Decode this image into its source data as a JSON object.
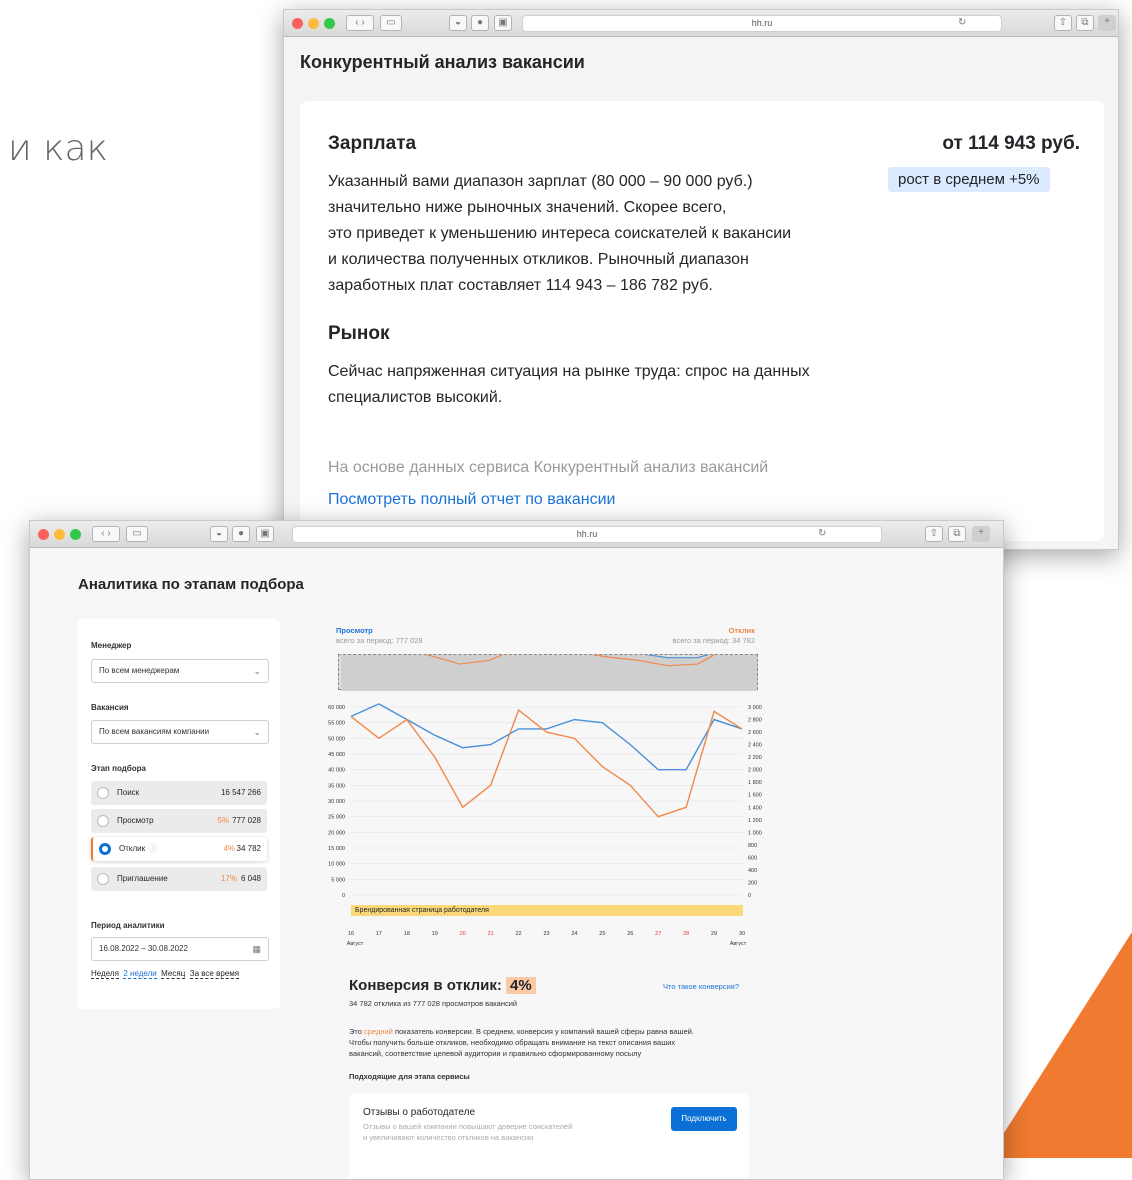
{
  "background": {
    "text": "и как",
    "accent": "#ef7a30"
  },
  "window1": {
    "url": "hh.ru",
    "title": "Конкурентный анализ вакансии",
    "salary": {
      "heading": "Зарплата",
      "value": "от 114 943 руб.",
      "badge": "рост в среднем +5%",
      "lines": [
        "Указанный вами диапазон зарплат (80 000 – 90 000 руб.)",
        "значительно ниже рыночных значений. Скорее всего,",
        "это приведет к уменьшению интереса соискателей к вакансии",
        "и количества полученных откликов. Рыночный диапазон",
        "заработных плат составляет 114 943 – 186 782 руб."
      ]
    },
    "market": {
      "heading": "Рынок",
      "lines": [
        "Сейчас напряженная ситуация на рынке труда: спрос на данных",
        "специалистов высокий."
      ]
    },
    "source_note": "На основе данных сервиса Конкурентный анализ вакансий",
    "full_report_link": "Посмотреть полный отчет по вакансии"
  },
  "window2": {
    "url": "hh.ru",
    "title": "Аналитика по этапам подбора",
    "manager": {
      "label": "Менеджер",
      "value": "По всем менеджерам"
    },
    "vacancy": {
      "label": "Вакансия",
      "value": "По всем вакансиям компании"
    },
    "stages": {
      "label": "Этап подбора",
      "items": [
        {
          "name": "Поиск",
          "pct": "",
          "value": "16 547 266",
          "selected": false
        },
        {
          "name": "Просмотр",
          "pct": "5%",
          "value": "777 028",
          "selected": false
        },
        {
          "name": "Отклик",
          "pct": "4%",
          "value": "34 782",
          "selected": true
        },
        {
          "name": "Приглашение",
          "pct": "17%",
          "value": "6 048",
          "selected": false
        }
      ]
    },
    "period": {
      "label": "Период аналитики",
      "value": "16.08.2022 – 30.08.2022",
      "links": [
        "Неделя",
        "2 недели",
        "Месяц",
        "За все время"
      ]
    },
    "conversion": {
      "title": "Конверсия в отклик:",
      "value": "4%",
      "subtitle": "34 782 отклика из 777 028 просмотров вакансий",
      "what_link": "Что такое конверсия?",
      "body_prefix": "Это",
      "body_highlight": "средний",
      "body_lines": [
        "показатель конверсии. В среднем, конверсия у компаний вашей сферы равна вашей.",
        "Чтобы получить больше откликов, необходимо обращать внимание на текст описания ваших",
        "вакансий, соответствие целевой аудитории и правильно сформированному посылу"
      ],
      "services_heading": "Подходящие для этапа сервисы"
    },
    "service": {
      "name": "Отзывы о работодателе",
      "desc1": "Отзывы о вашей компании повышают доверие соискателей",
      "desc2": "и увеличивают количество откликов на вакансии",
      "button": "Подключить"
    }
  },
  "chart_data": {
    "type": "line",
    "series": [
      {
        "name": "Просмотр",
        "color": "#4a90d9",
        "total_label": "всего за период: 777 028",
        "values": [
          57000,
          61000,
          56000,
          51000,
          47000,
          48000,
          53000,
          53000,
          56000,
          55000,
          48000,
          40000,
          40000,
          56000,
          53000
        ]
      },
      {
        "name": "Отклик",
        "color": "#f0884a",
        "total_label": "всего за период: 34 782",
        "values": [
          2850,
          2500,
          2800,
          2200,
          1400,
          1750,
          2950,
          2600,
          2500,
          2050,
          1750,
          1250,
          1400,
          2930,
          2650
        ]
      }
    ],
    "x": [
      "16",
      "17",
      "18",
      "19",
      "20",
      "21",
      "22",
      "23",
      "24",
      "25",
      "26",
      "27",
      "28",
      "29",
      "30"
    ],
    "weekend_x": [
      "20",
      "21",
      "27",
      "28"
    ],
    "x_month_label": "Август",
    "y_left_ticks": [
      "60 000",
      "55 000",
      "50 000",
      "45 000",
      "40 000",
      "35 000",
      "30 000",
      "25 000",
      "20 000",
      "15 000",
      "10 000",
      "5 000",
      "0"
    ],
    "y_right_ticks": [
      "3 000",
      "2 800",
      "2 600",
      "2 400",
      "2 200",
      "2 000",
      "1 800",
      "1 600",
      "1 400",
      "1 200",
      "1 000",
      "800",
      "600",
      "400",
      "200",
      "0"
    ],
    "ylim_left": [
      0,
      60000
    ],
    "ylim_right": [
      0,
      3000
    ],
    "event_label": "Брендированная страница работодателя"
  }
}
